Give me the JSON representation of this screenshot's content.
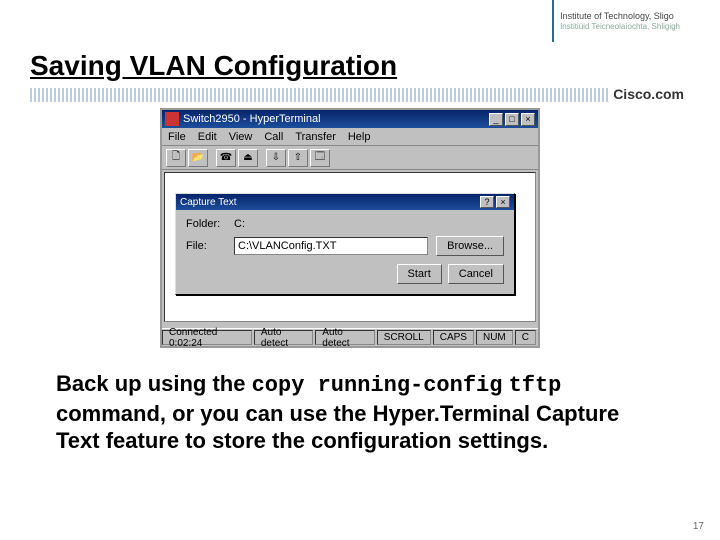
{
  "header": {
    "institute_line1": "Institute of Technology, Sligo",
    "institute_line2": "Institiúid Teicneolaíochta, Shligigh"
  },
  "slide": {
    "title": "Saving VLAN Configuration",
    "cisco": "Cisco.com",
    "body_pre": "Back up using the ",
    "body_code1": "copy running-config",
    "body_code2": "tftp",
    "body_post": " command, or you can use the Hyper.Terminal Capture Text feature to store the configuration settings.",
    "page_number": "17"
  },
  "hyperterminal": {
    "window_title": "Switch2950 - HyperTerminal",
    "menu": [
      "File",
      "Edit",
      "View",
      "Call",
      "Transfer",
      "Help"
    ],
    "toolbar_icons": [
      "new-icon",
      "open-icon",
      "connect-icon",
      "disconnect-icon",
      "send-icon",
      "receive-icon",
      "properties-icon"
    ],
    "status": {
      "connected": "Connected 0:02:24",
      "detect1": "Auto detect",
      "detect2": "Auto detect",
      "scroll": "SCROLL",
      "caps": "CAPS",
      "num": "NUM",
      "c": "C"
    }
  },
  "dialog": {
    "title": "Capture Text",
    "folder_label": "Folder:",
    "folder_value": "C:",
    "file_label": "File:",
    "file_value": "C:\\VLANConfig.TXT",
    "browse": "Browse...",
    "start": "Start",
    "cancel": "Cancel"
  }
}
